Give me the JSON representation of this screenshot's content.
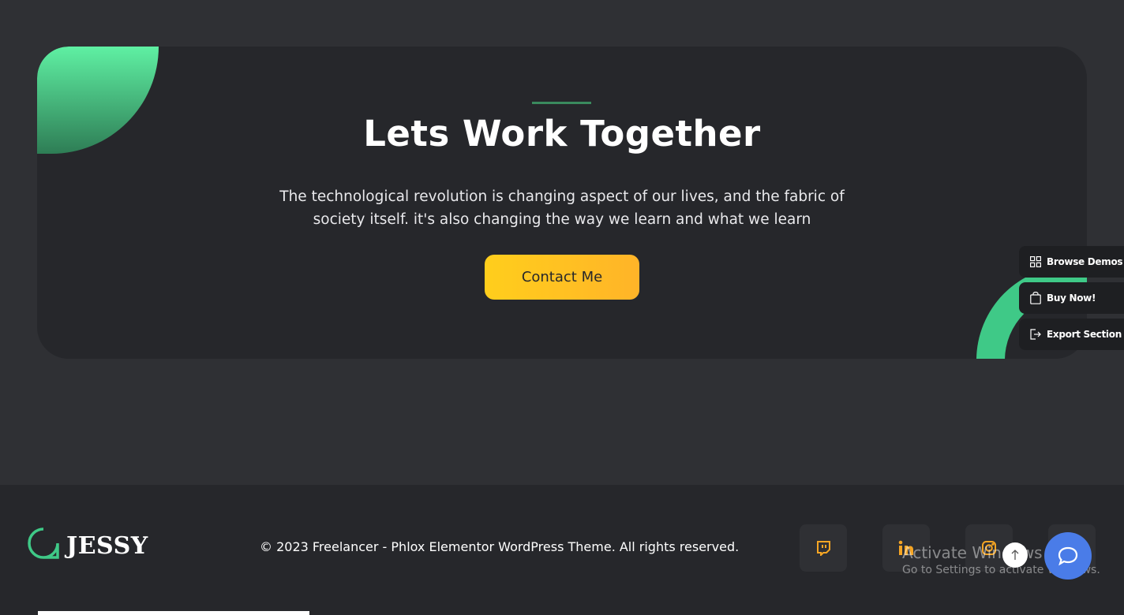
{
  "cta": {
    "title": "Lets Work Together",
    "line1": "The technological revolution is changing aspect of our lives, and the fabric of",
    "line2": "society itself. it's also changing the way we learn and what we learn",
    "button_label": "Contact Me"
  },
  "side_panel": {
    "browse_demos": "Browse Demos",
    "buy_now": "Buy Now!",
    "export_section": "Export Section"
  },
  "footer": {
    "logo_text": "JESSY",
    "copyright": "© 2023 Freelancer - Phlox Elementor WordPress Theme. All rights reserved.",
    "social_icons": [
      "twitch-icon",
      "linkedin-icon",
      "instagram-icon"
    ]
  },
  "watermark": {
    "title": "Activate Windows",
    "subtitle": "Go to Settings to activate Windows."
  },
  "colors": {
    "background": "#2f3034",
    "card": "#26272b",
    "accent_green": "#3fc987",
    "button_yellow": "#ffc21f",
    "icon_orange": "#f5a524",
    "chat_blue": "#4a7ce8"
  }
}
